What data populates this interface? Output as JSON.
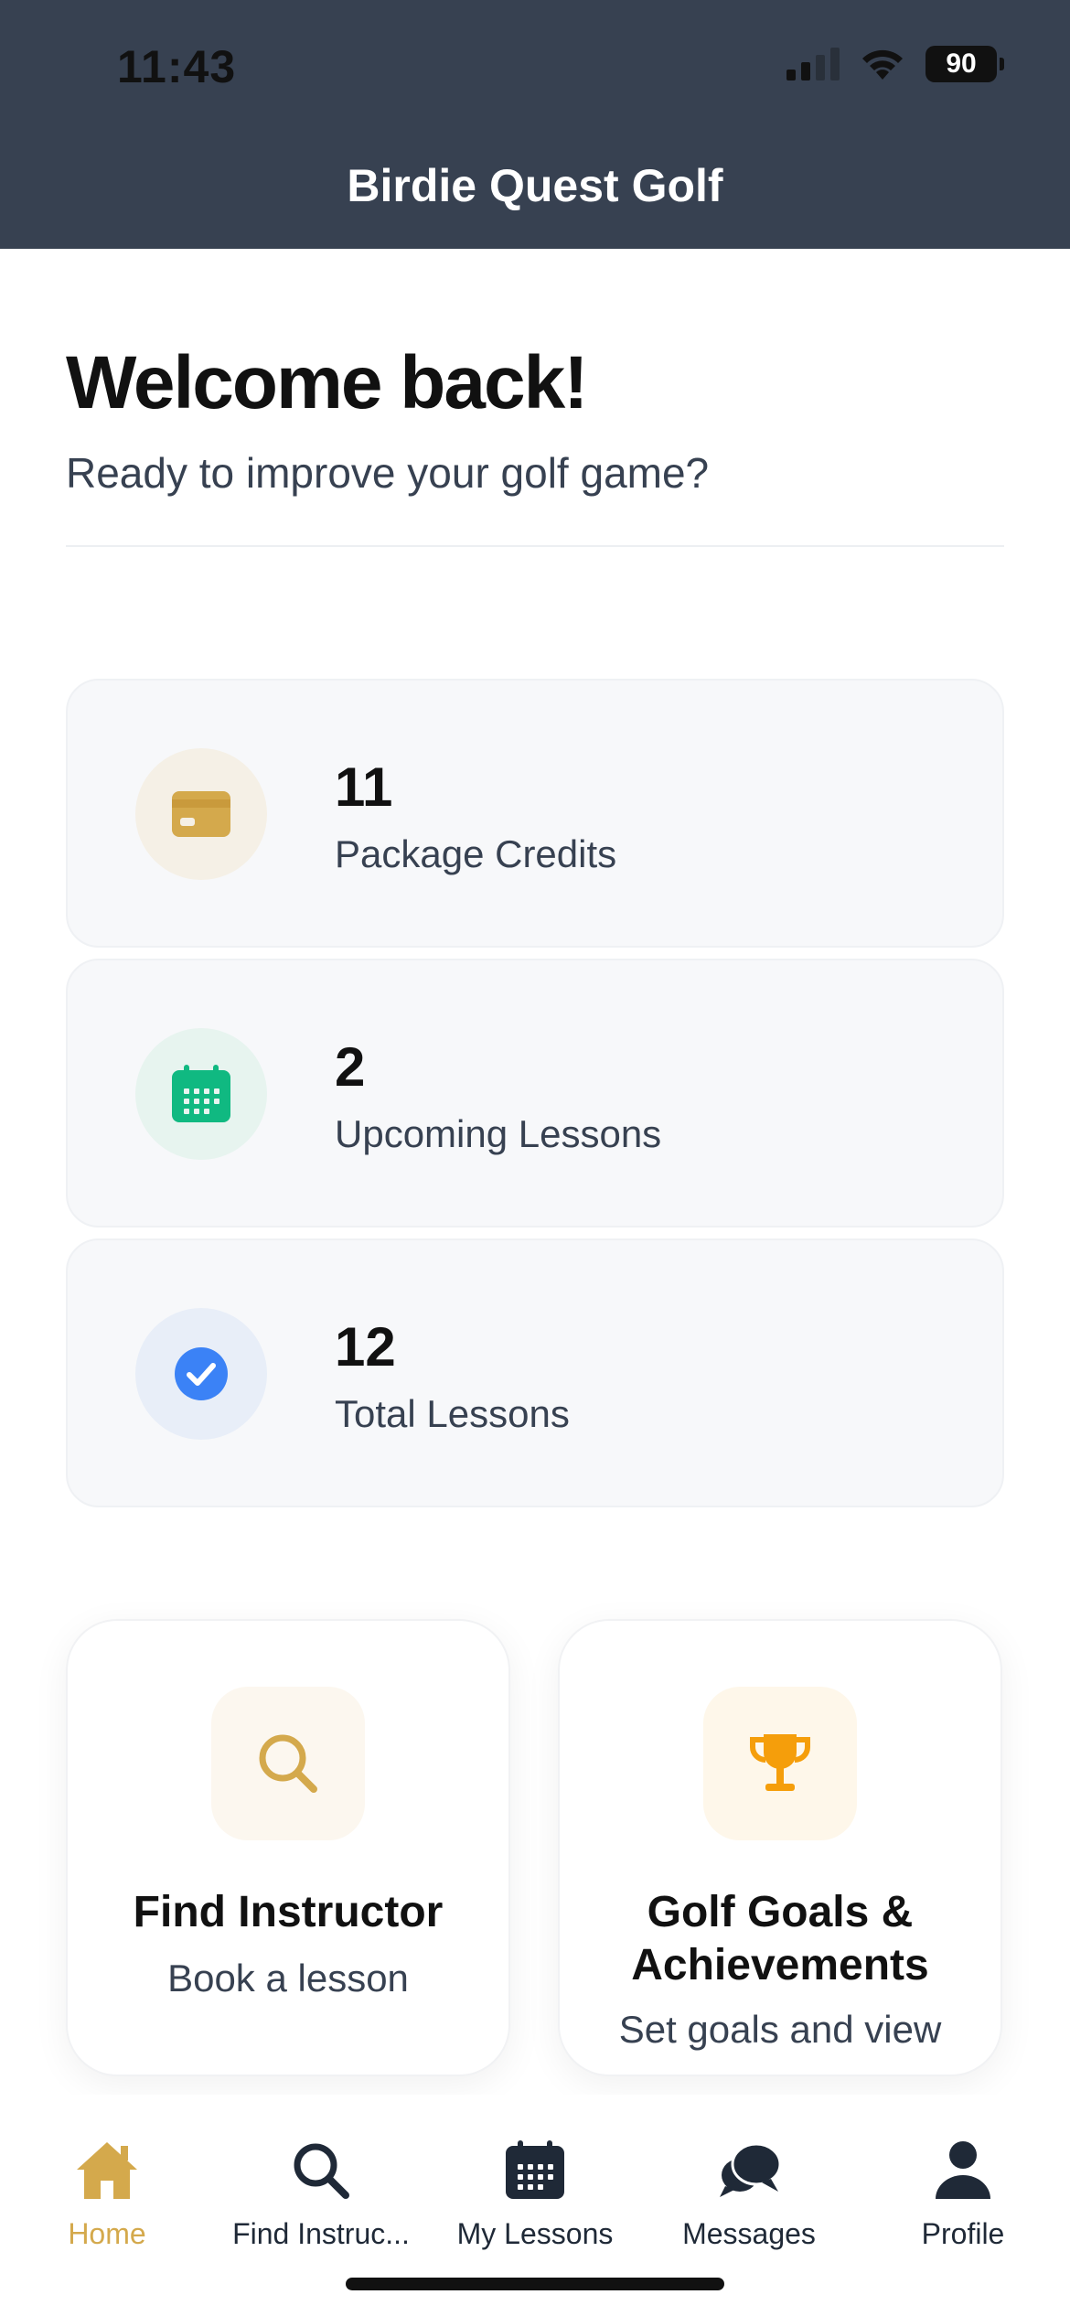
{
  "status_bar": {
    "time": "11:43",
    "battery": "90"
  },
  "header": {
    "title": "Birdie Quest Golf"
  },
  "welcome": {
    "title": "Welcome back!",
    "subtitle": "Ready to improve your golf game?"
  },
  "stats": [
    {
      "value": "11",
      "label": "Package Credits",
      "icon": "credit-card-icon",
      "color": "#d4a94c",
      "bg": "#f5f0e6"
    },
    {
      "value": "2",
      "label": "Upcoming Lessons",
      "icon": "calendar-icon",
      "color": "#10b981",
      "bg": "#e7f4ef"
    },
    {
      "value": "12",
      "label": "Total Lessons",
      "icon": "check-circle-icon",
      "color": "#3b82f6",
      "bg": "#e8eef8"
    }
  ],
  "actions": [
    {
      "title": "Find Instructor",
      "subtitle": "Book a lesson",
      "icon": "search-icon",
      "color": "#d4a94c",
      "bg": "#fcf7ef"
    },
    {
      "title": "Golf Goals & Achievements",
      "subtitle": "Set goals and view",
      "icon": "trophy-icon",
      "color": "#f59e0b",
      "bg": "#fef7ea"
    }
  ],
  "tabs": [
    {
      "label": "Home",
      "icon": "home-icon",
      "active": true
    },
    {
      "label": "Find Instruc...",
      "icon": "search-icon",
      "active": false
    },
    {
      "label": "My Lessons",
      "icon": "calendar-icon",
      "active": false
    },
    {
      "label": "Messages",
      "icon": "chat-bubbles-icon",
      "active": false
    },
    {
      "label": "Profile",
      "icon": "person-icon",
      "active": false
    }
  ],
  "colors": {
    "header_bg": "#374151",
    "accent_gold": "#d4a94c",
    "tab_inactive": "#1f2937"
  }
}
